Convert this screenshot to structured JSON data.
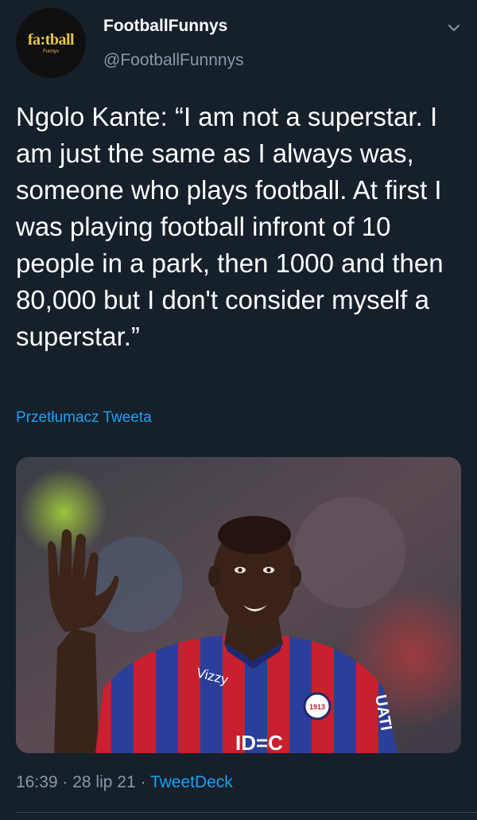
{
  "tweet": {
    "avatar": {
      "logo_text": "fa:tball",
      "logo_sub": "Funnys"
    },
    "display_name": "FootballFunnys",
    "handle": "@FootballFunnnys",
    "menu_icon": "chevron-down-icon",
    "text": "Ngolo Kante: “I am not a superstar. I am just the same as I always was, someone who plays football. At first I was playing football infront of 10 people in a park, then 1000 and then 80,000 but I don't consider myself a superstar.”",
    "translate_label": "Przetłumacz Tweeta",
    "media": {
      "jersey_sponsor": "Vizzy",
      "jersey_sponsor_2": "ID=C",
      "badge_text": "1913",
      "sleeve_text": "UATI"
    },
    "meta": {
      "time": "16:39",
      "separator": " · ",
      "date": "28 lip 21",
      "source": "TweetDeck"
    }
  },
  "colors": {
    "background": "#15202b",
    "primary_text": "#ffffff",
    "secondary_text": "#8899a6",
    "link": "#1da1f2",
    "logo_gold": "#e8c44a"
  }
}
